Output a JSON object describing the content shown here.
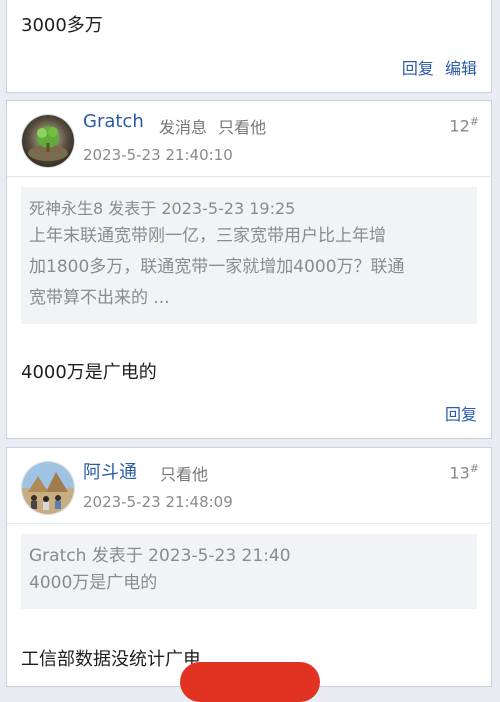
{
  "post_prev": {
    "text": "3000多万",
    "actions": {
      "reply": "回复",
      "edit": "编辑"
    }
  },
  "post_12": {
    "author": "Gratch",
    "send_message": "发消息",
    "only_view": "只看他",
    "floor_number": "12",
    "floor_mark": "#",
    "time": "2023-5-23 21:40:10",
    "quote": {
      "header": "死神永生8 发表于 2023-5-23 19:25",
      "lines": [
        "上年末联通宽带刚一亿，三家宽带用户比上年增",
        "加1800多万，联通宽带一家就增加4000万？联通",
        "宽带算不出来的 ..."
      ]
    },
    "text": "4000万是广电的",
    "reply": "回复"
  },
  "post_13": {
    "author": "阿斗通",
    "only_view": "只看他",
    "floor_number": "13",
    "floor_mark": "#",
    "time": "2023-5-23 21:48:09",
    "quote": {
      "header": "Gratch 发表于 2023-5-23 21:40",
      "line": "4000万是广电的"
    },
    "text": "工信部数据没统计广电"
  },
  "colors": {
    "link": "#2a5aa8",
    "background": "#e9edf3",
    "fab": "#e23322"
  }
}
